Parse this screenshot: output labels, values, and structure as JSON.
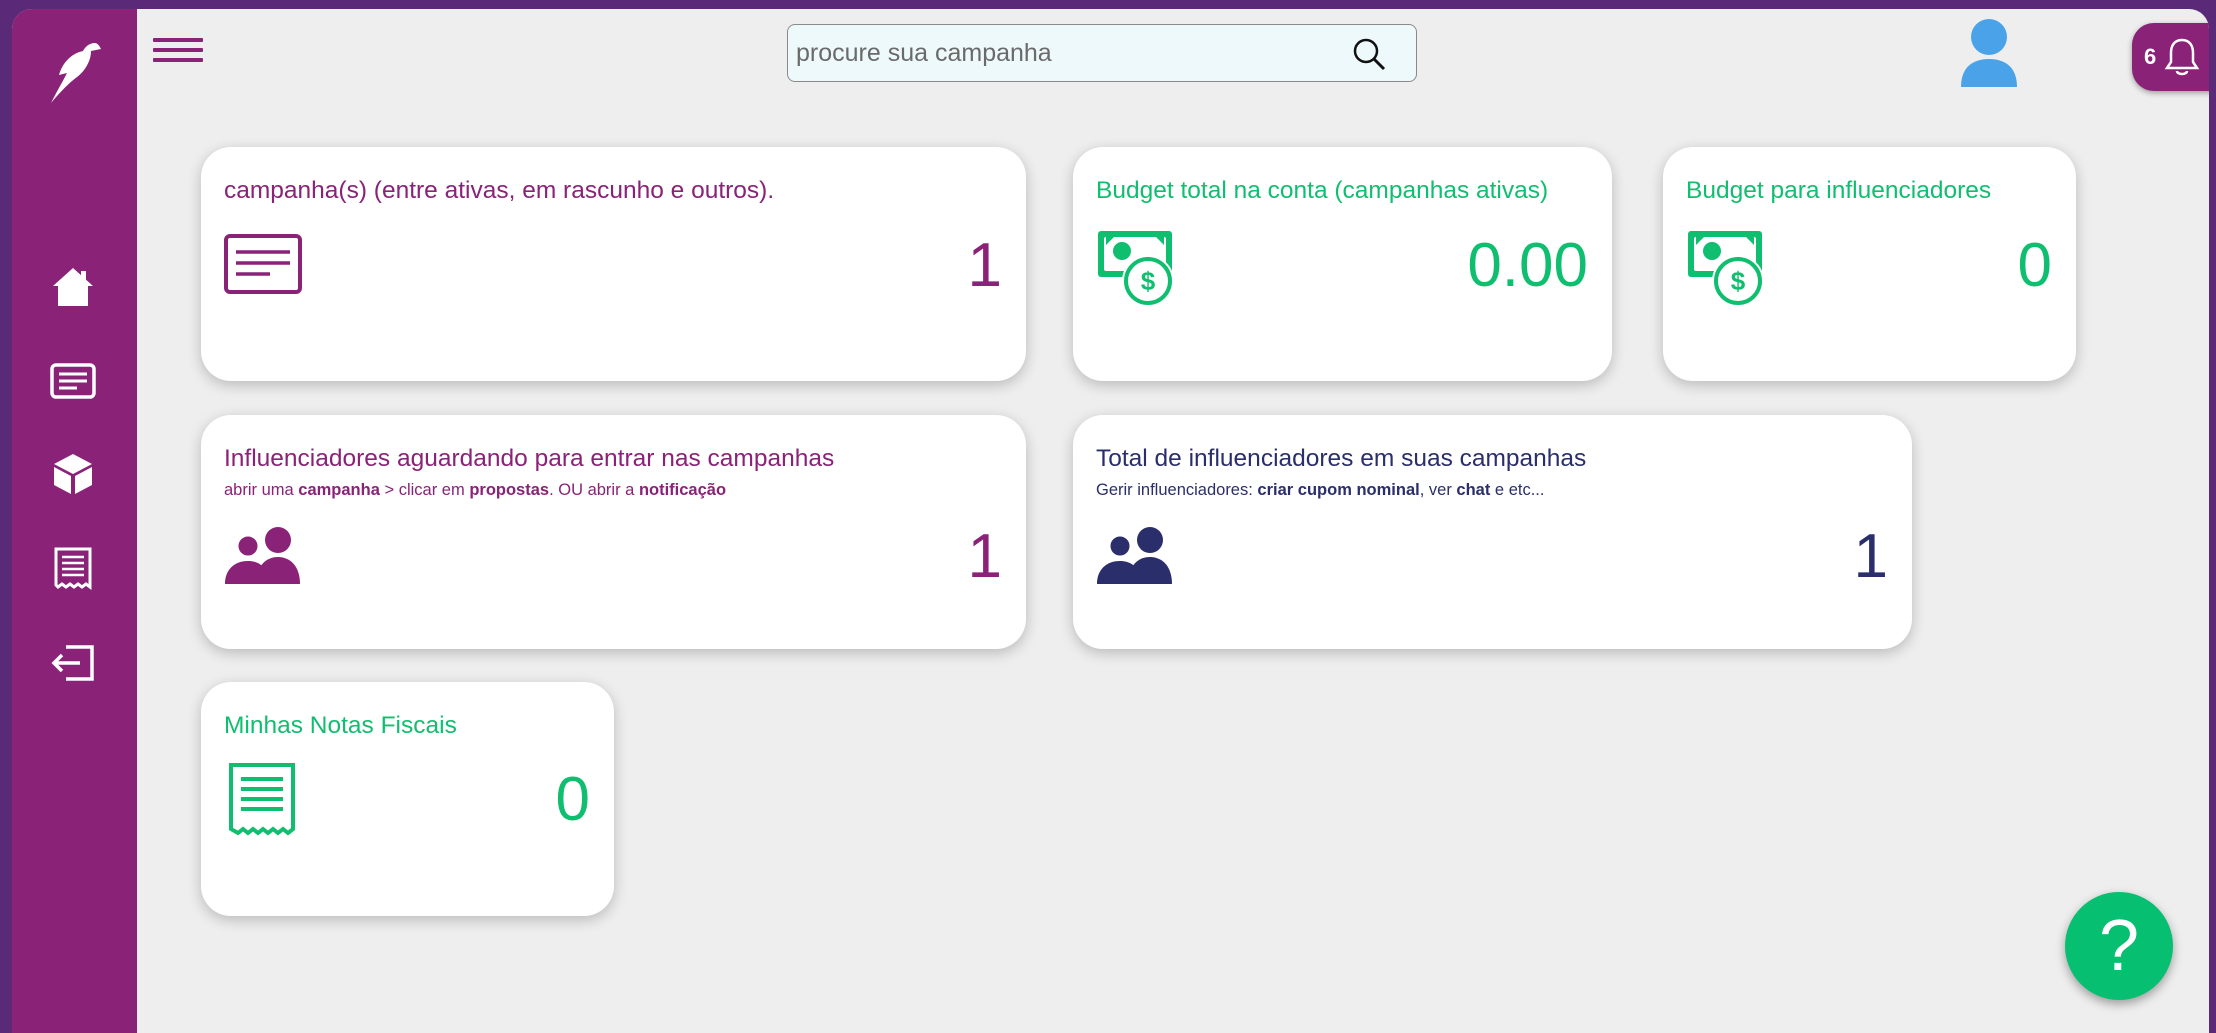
{
  "search": {
    "placeholder": "procure sua campanha",
    "value": ""
  },
  "notifications": {
    "count": "6"
  },
  "sidebar": {
    "items": [
      {
        "name": "home",
        "icon": "home-icon"
      },
      {
        "name": "campaigns",
        "icon": "document-icon"
      },
      {
        "name": "products",
        "icon": "cube-icon"
      },
      {
        "name": "invoices",
        "icon": "receipt-icon"
      },
      {
        "name": "logout",
        "icon": "logout-icon"
      }
    ]
  },
  "cards": {
    "campaigns": {
      "title": "campanha(s) (entre ativas, em rascunho e outros).",
      "value": "1"
    },
    "budget_total": {
      "title": "Budget total na conta (campanhas ativas)",
      "value": "0.00"
    },
    "budget_influencers": {
      "title": "Budget para influenciadores",
      "value": "0"
    },
    "waiting": {
      "title": "Influenciadores aguardando para entrar nas campanhas",
      "sub": {
        "t1": "abrir uma ",
        "b1": "campanha",
        "t2": " > clicar em ",
        "b2": "propostas",
        "t3": ". OU abrir a ",
        "b3": "notificação"
      },
      "value": "1"
    },
    "total_influencers": {
      "title": "Total de influenciadores em suas campanhas",
      "sub": {
        "t1": "Gerir influenciadores: ",
        "b1": "criar cupom nominal",
        "t2": ", ver ",
        "b2": "chat",
        "t3": " e etc..."
      },
      "value": "1"
    },
    "invoices": {
      "title": "Minhas Notas Fiscais",
      "value": "0"
    }
  },
  "help": {
    "label": "?"
  },
  "colors": {
    "purple": "#8a2278",
    "green": "#0fbf6f",
    "navy": "#2a2e6b",
    "avatar": "#4aa3e8"
  }
}
